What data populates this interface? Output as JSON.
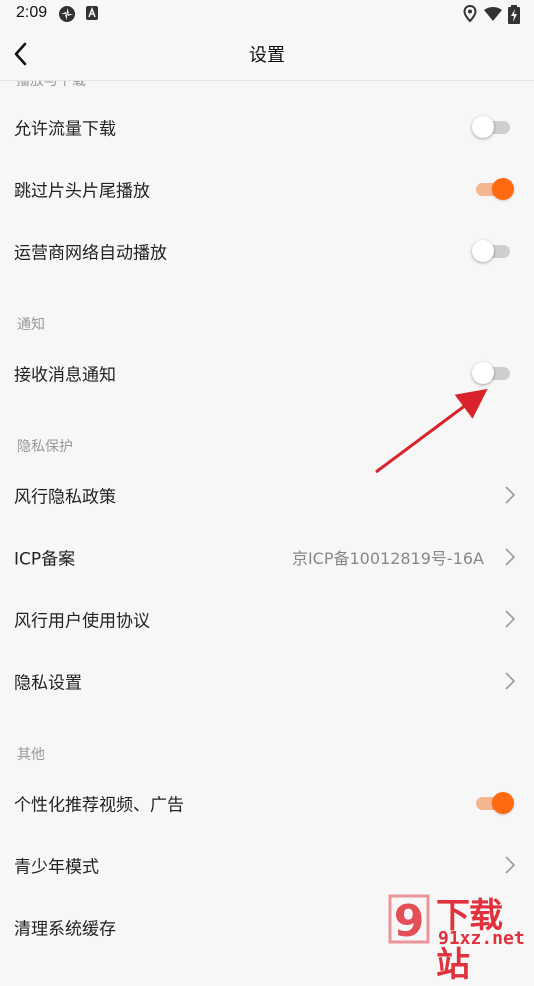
{
  "status_bar": {
    "time": "2:09"
  },
  "nav": {
    "title": "设置"
  },
  "sections": {
    "playback_cut": "播放与下载",
    "notify": "通知",
    "privacy": "隐私保护",
    "other": "其他"
  },
  "rows": {
    "allow_data_download": {
      "label": "允许流量下载",
      "on": false
    },
    "skip_intro_outro": {
      "label": "跳过片头片尾播放",
      "on": true
    },
    "carrier_autoplay": {
      "label": "运营商网络自动播放",
      "on": false
    },
    "receive_notifications": {
      "label": "接收消息通知",
      "on": false
    },
    "privacy_policy": {
      "label": "风行隐私政策"
    },
    "icp": {
      "label": "ICP备案",
      "value": "京ICP备10012819号-16A"
    },
    "user_agreement": {
      "label": "风行用户使用协议"
    },
    "privacy_settings": {
      "label": "隐私设置"
    },
    "personalized_ads": {
      "label": "个性化推荐视频、广告",
      "on": true
    },
    "teen_mode": {
      "label": "青少年模式"
    },
    "clear_cache": {
      "label": "清理系统缓存"
    }
  },
  "colors": {
    "accent": "#ff6a10",
    "annotation_arrow": "#d8232a",
    "watermark": "#e0313c"
  },
  "watermark": {
    "big": "下载站",
    "small": "91xz.net",
    "logo_text": "9"
  }
}
